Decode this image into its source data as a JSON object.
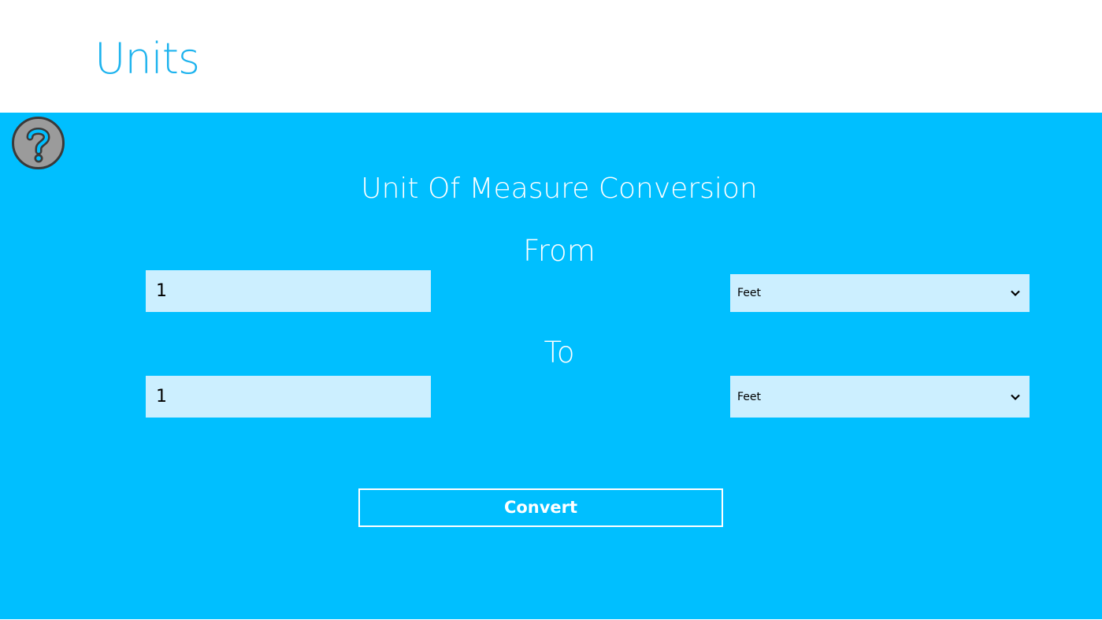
{
  "app": {
    "title": "Units"
  },
  "help": {
    "icon": "help-question-icon"
  },
  "converter": {
    "title": "Unit Of Measure Conversion",
    "from_label": "From",
    "to_label": "To",
    "from_value": "1",
    "to_value": "1",
    "from_unit": "Feet",
    "to_unit": "Feet",
    "convert_label": "Convert"
  },
  "colors": {
    "accent": "#00bfff",
    "title": "#1db3ee",
    "input_bg": "#ccefff",
    "text_on_accent": "#ffffff"
  }
}
